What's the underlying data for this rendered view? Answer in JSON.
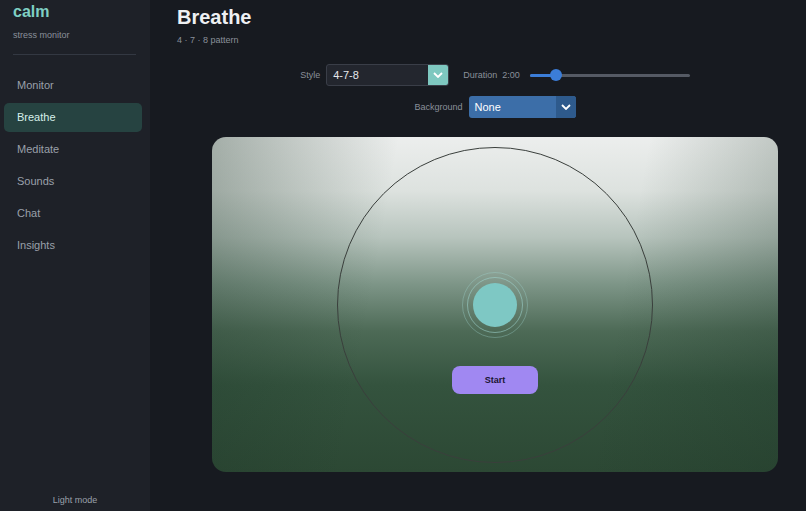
{
  "brand": {
    "logo": "calm",
    "tagline": "stress monitor"
  },
  "sidebar": {
    "items": [
      {
        "label": "Monitor",
        "selected": false
      },
      {
        "label": "Breathe",
        "selected": true
      },
      {
        "label": "Meditate",
        "selected": false
      },
      {
        "label": "Sounds",
        "selected": false
      },
      {
        "label": "Chat",
        "selected": false
      },
      {
        "label": "Insights",
        "selected": false
      }
    ]
  },
  "theme_toggle": "Light mode",
  "page": {
    "title": "Breathe",
    "subtitle": "4 · 7 · 8  pattern"
  },
  "controls": {
    "style": {
      "label": "Style",
      "value": "4-7-8"
    },
    "duration": {
      "label": "Duration",
      "reading": "2:00",
      "level": 0.16
    },
    "background": {
      "label": "Background",
      "value": "None"
    }
  },
  "stage": {
    "start_button": "Start"
  }
}
